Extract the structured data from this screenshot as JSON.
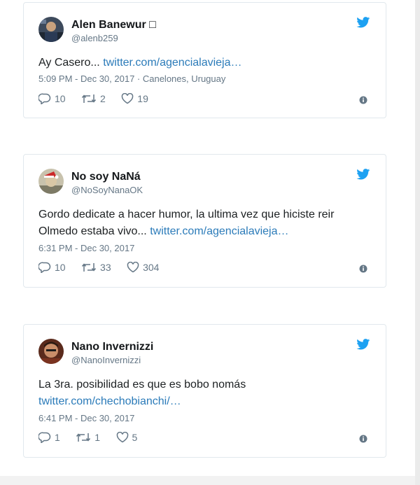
{
  "colors": {
    "link": "#2b7bb9",
    "twitter_blue": "#1da1f2",
    "muted": "#657786",
    "text": "#1c2022"
  },
  "tweets": [
    {
      "name": "Alen Banewur □",
      "handle": "@alenb259",
      "text": "Ay Casero... ",
      "link": "twitter.com/agencialavieja…",
      "meta": "5:09 PM - Dec 30, 2017 · Canelones, Uruguay",
      "replies": "10",
      "retweets": "2",
      "likes": "19"
    },
    {
      "name": "No soy NaNá",
      "handle": "@NoSoyNanaOK",
      "text": "Gordo dedicate a hacer humor, la ultima vez que hiciste reir Olmedo estaba vivo... ",
      "link": "twitter.com/agencialavieja…",
      "meta": "6:31 PM - Dec 30, 2017",
      "replies": "10",
      "retweets": "33",
      "likes": "304"
    },
    {
      "name": "Nano Invernizzi",
      "handle": "@NanoInvernizzi",
      "text": "La 3ra. posibilidad es que es bobo nomás ",
      "link": "twitter.com/chechobianchi/…",
      "meta": "6:41 PM - Dec 30, 2017",
      "replies": "1",
      "retweets": "1",
      "likes": "5"
    }
  ]
}
